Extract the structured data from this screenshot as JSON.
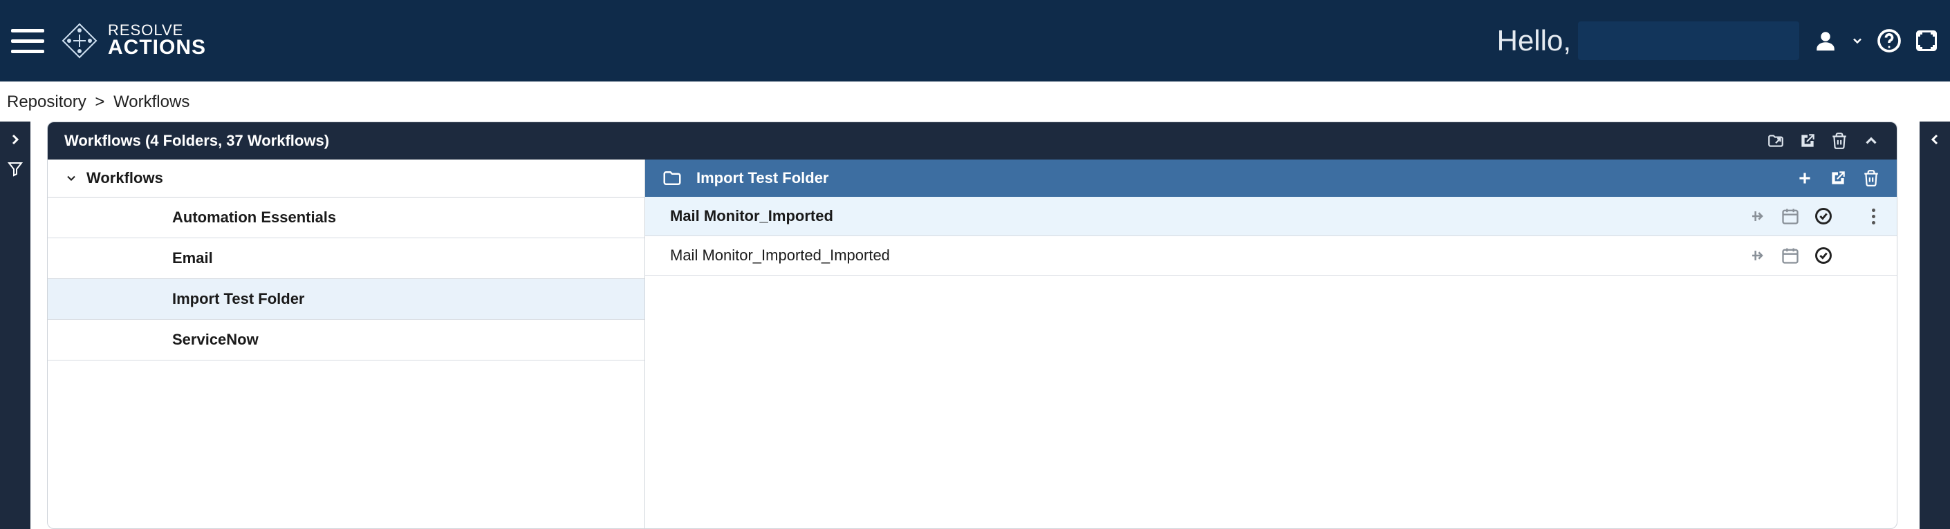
{
  "header": {
    "brand_line1": "RESOLVE",
    "brand_line2": "ACTIONS",
    "greeting": "Hello,"
  },
  "breadcrumb": {
    "root": "Repository",
    "sep": ">",
    "current": "Workflows"
  },
  "panel": {
    "title": "Workflows (4 Folders, 37 Workflows)"
  },
  "tree": {
    "root_label": "Workflows",
    "items": [
      {
        "label": "Automation Essentials",
        "selected": false
      },
      {
        "label": "Email",
        "selected": false
      },
      {
        "label": "Import Test Folder",
        "selected": true
      },
      {
        "label": "ServiceNow",
        "selected": false
      }
    ]
  },
  "folder": {
    "name": "Import Test Folder"
  },
  "rows": [
    {
      "name": "Mail Monitor_Imported",
      "selected": true
    },
    {
      "name": "Mail Monitor_Imported_Imported",
      "selected": false
    }
  ]
}
